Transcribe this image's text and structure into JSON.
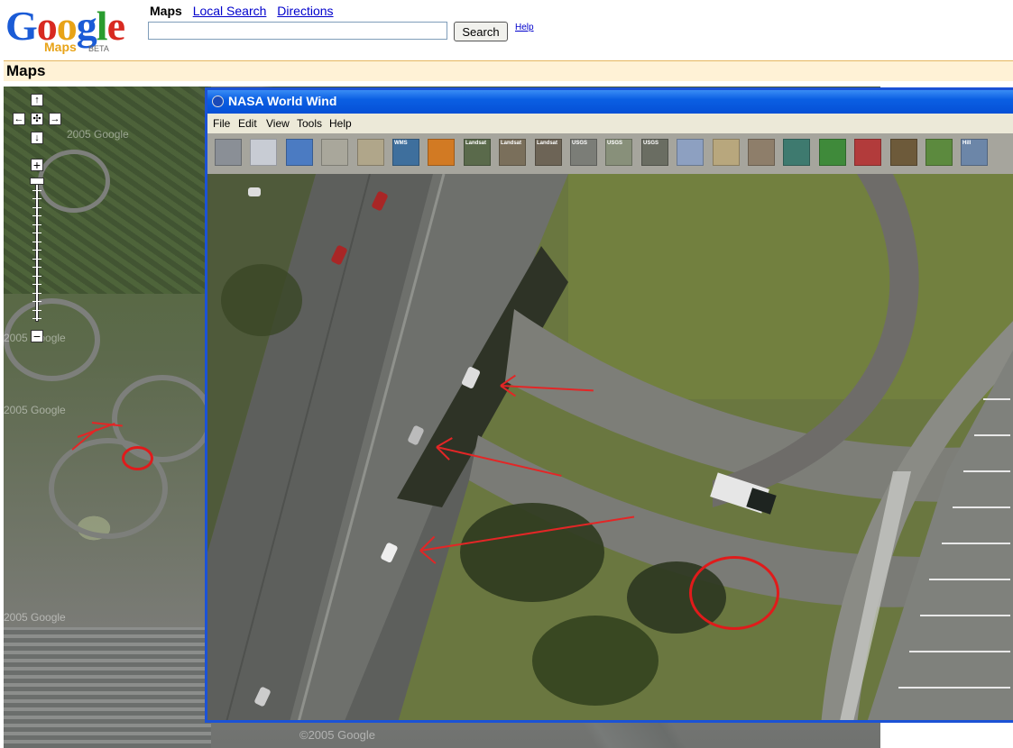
{
  "google": {
    "logo_text": "Google",
    "logo_sub": "Maps",
    "beta": "BETA",
    "nav": {
      "current": "Maps",
      "local_search": "Local Search",
      "directions": "Directions"
    },
    "search": {
      "value": "",
      "button": "Search"
    },
    "help": "Help",
    "section_title": "Maps",
    "map": {
      "watermarks": [
        "2005 Google",
        "2005 Google",
        "2005 Google",
        "2005 Google",
        "©2005 Google"
      ]
    },
    "controls": {
      "up": "↑",
      "left": "←",
      "center": "✣",
      "right": "→",
      "down": "↓",
      "zoom_in": "+",
      "zoom_out": "−",
      "zoom_level": 0.0
    }
  },
  "worldwind": {
    "title": "NASA World Wind",
    "menu": [
      "File",
      "Edit",
      "View",
      "Tools",
      "Help"
    ],
    "toolbar": [
      {
        "icon": "layers-icon",
        "label": "",
        "color": "#8a8f96"
      },
      {
        "icon": "grid-icon",
        "label": "",
        "color": "#c8ccd4"
      },
      {
        "icon": "globe-icon",
        "label": "",
        "color": "#4b7bc2"
      },
      {
        "icon": "search-icon",
        "label": "",
        "color": "#a9a79b"
      },
      {
        "icon": "scale-icon",
        "label": "",
        "color": "#b0a68a"
      },
      {
        "icon": "wms-icon",
        "label": "WMS",
        "color": "#3e6f9d"
      },
      {
        "icon": "heat-map-icon",
        "label": "",
        "color": "#d27a23"
      },
      {
        "icon": "landsat-pseudo-icon",
        "label": "Landsat",
        "color": "#5a6a4b"
      },
      {
        "icon": "landsat-visible-icon",
        "label": "Landsat",
        "color": "#7a6f5b"
      },
      {
        "icon": "landsat-pseudo2-icon",
        "label": "Landsat",
        "color": "#6d6456"
      },
      {
        "icon": "usgs-ortho-icon",
        "label": "USGS",
        "color": "#7b7d77"
      },
      {
        "icon": "usgs-topo-icon",
        "label": "USGS",
        "color": "#88907a"
      },
      {
        "icon": "usgs-urban-icon",
        "label": "USGS",
        "color": "#6a6d62"
      },
      {
        "icon": "zoomit-icon",
        "label": "",
        "color": "#8da0c1"
      },
      {
        "icon": "compass-icon",
        "label": "",
        "color": "#b8a77d"
      },
      {
        "icon": "place-names-icon",
        "label": "",
        "color": "#8e7e6a"
      },
      {
        "icon": "landmarks-icon",
        "label": "",
        "color": "#3e7a6f"
      },
      {
        "icon": "boundaries-icon",
        "label": "",
        "color": "#3f8a3a"
      },
      {
        "icon": "flags-icon",
        "label": "",
        "color": "#b23b3b"
      },
      {
        "icon": "geocache-icon",
        "label": "",
        "color": "#6d5a3a"
      },
      {
        "icon": "map-icon",
        "label": "",
        "color": "#5c8a3e"
      },
      {
        "icon": "hill-icon",
        "label": "Hill",
        "color": "#6c86a8"
      }
    ]
  }
}
